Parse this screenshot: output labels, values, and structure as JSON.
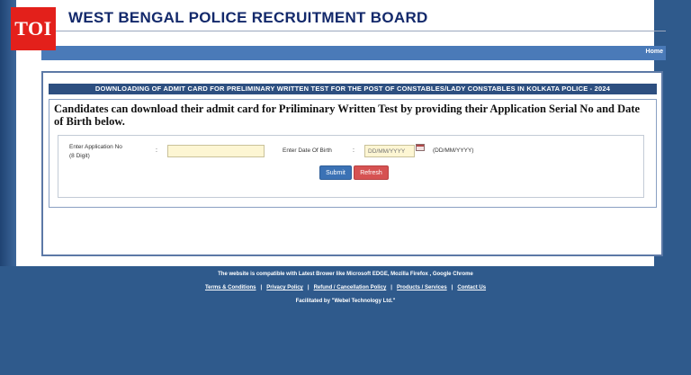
{
  "watermark": {
    "text": "TOI"
  },
  "header": {
    "title": "WEST BENGAL POLICE RECRUITMENT BOARD"
  },
  "nav": {
    "home_label": "Home"
  },
  "banner": {
    "text": "DOWNLOADING OF ADMIT CARD FOR PRELIMINARY WRITTEN TEST FOR THE POST OF CONSTABLES/LADY CONSTABLES IN KOLKATA POLICE - 2024"
  },
  "instruction": {
    "text": "Candidates can download their admit card for Priliminary Written Test by providing their Application Serial No and Date of Birth below."
  },
  "form": {
    "application_label_line1": "Enter Application No",
    "application_label_line2": "(8 Digit)",
    "colon": ":",
    "application_value": "",
    "dob_label": "Enter Date Of Birth",
    "dob_placeholder": "DD/MM/YYYY",
    "dob_format_hint": "(DD/MM/YYYY)",
    "submit_label": "Submit",
    "refresh_label": "Refresh"
  },
  "footer": {
    "compat_text": "The website is compatible with Latest Brower like Microsoft EDGE, Mozilla Firefox , Google Chrome",
    "links": [
      "Terms & Conditions",
      "Privacy Policy",
      "Refund / Cancellation Policy",
      "Products / Services",
      "Contact Us"
    ],
    "separator": "|",
    "facilitated": "Facilitated by \"Webel Technology Ltd.\""
  },
  "colors": {
    "background": "#2f5a8c",
    "header_title": "#13296b",
    "navbar": "#4a7ab8",
    "banner": "#2d4f80",
    "submit": "#3b72b5",
    "refresh": "#d65252",
    "input_fill": "#fdf6d3",
    "toi_badge": "#e3201b"
  },
  "icons": {
    "calendar": "calendar-icon"
  }
}
